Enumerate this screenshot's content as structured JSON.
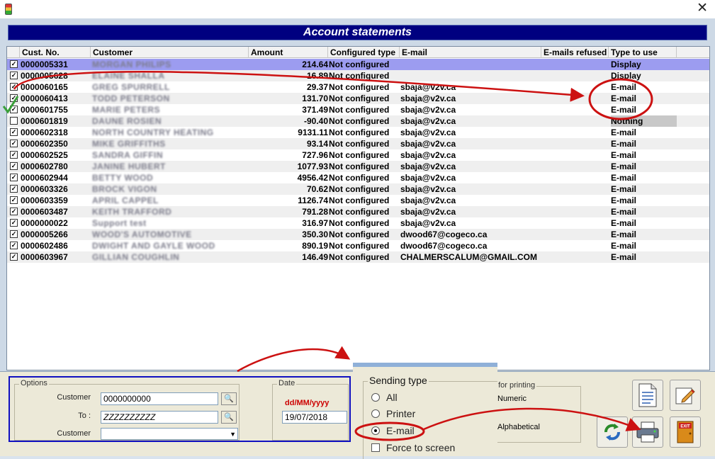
{
  "window": {
    "title": ""
  },
  "header": {
    "title": "Account statements"
  },
  "grid": {
    "columns": [
      "Cust. No.",
      "Customer",
      "Amount",
      "Configured type",
      "E-mail",
      "E-mails refused",
      "Type to use"
    ],
    "rows": [
      {
        "checked": true,
        "cust_no": "0000005331",
        "customer": "MORGAN PHILIPS",
        "amount": "214.64",
        "configured": "Not configured",
        "email": "",
        "refused": "",
        "type": "Display"
      },
      {
        "checked": true,
        "cust_no": "0000005628",
        "customer": "ELAINE SHALLA",
        "amount": "16.89",
        "configured": "Not configured",
        "email": "",
        "refused": "",
        "type": "Display"
      },
      {
        "checked": true,
        "cust_no": "0000060165",
        "customer": "GREG SPURRELL",
        "amount": "29.37",
        "configured": "Not configured",
        "email": "sbaja@v2v.ca",
        "refused": "",
        "type": "E-mail"
      },
      {
        "checked": true,
        "cust_no": "0000060413",
        "customer": "TODD PETERSON",
        "amount": "131.70",
        "configured": "Not configured",
        "email": "sbaja@v2v.ca",
        "refused": "",
        "type": "E-mail"
      },
      {
        "checked": true,
        "cust_no": "0000601755",
        "customer": "MARIE PETERS",
        "amount": "371.49",
        "configured": "Not configured",
        "email": "sbaja@v2v.ca",
        "refused": "",
        "type": "E-mail"
      },
      {
        "checked": false,
        "cust_no": "0000601819",
        "customer": "DAUNE ROSIEN",
        "amount": "-90.40",
        "configured": "Not configured",
        "email": "sbaja@v2v.ca",
        "refused": "",
        "type": "Nothing"
      },
      {
        "checked": true,
        "cust_no": "0000602318",
        "customer": "NORTH COUNTRY HEATING",
        "amount": "9131.11",
        "configured": "Not configured",
        "email": "sbaja@v2v.ca",
        "refused": "",
        "type": "E-mail"
      },
      {
        "checked": true,
        "cust_no": "0000602350",
        "customer": "MIKE GRIFFITHS",
        "amount": "93.14",
        "configured": "Not configured",
        "email": "sbaja@v2v.ca",
        "refused": "",
        "type": "E-mail"
      },
      {
        "checked": true,
        "cust_no": "0000602525",
        "customer": "SANDRA GIFFIN",
        "amount": "727.96",
        "configured": "Not configured",
        "email": "sbaja@v2v.ca",
        "refused": "",
        "type": "E-mail"
      },
      {
        "checked": true,
        "cust_no": "0000602780",
        "customer": "JANINE HUBERT",
        "amount": "1077.93",
        "configured": "Not configured",
        "email": "sbaja@v2v.ca",
        "refused": "",
        "type": "E-mail"
      },
      {
        "checked": true,
        "cust_no": "0000602944",
        "customer": "BETTY WOOD",
        "amount": "4956.42",
        "configured": "Not configured",
        "email": "sbaja@v2v.ca",
        "refused": "",
        "type": "E-mail"
      },
      {
        "checked": true,
        "cust_no": "0000603326",
        "customer": "BROCK VIGON",
        "amount": "70.62",
        "configured": "Not configured",
        "email": "sbaja@v2v.ca",
        "refused": "",
        "type": "E-mail"
      },
      {
        "checked": true,
        "cust_no": "0000603359",
        "customer": "APRIL CAPPEL",
        "amount": "1126.74",
        "configured": "Not configured",
        "email": "sbaja@v2v.ca",
        "refused": "",
        "type": "E-mail"
      },
      {
        "checked": true,
        "cust_no": "0000603487",
        "customer": "KEITH TRAFFORD",
        "amount": "791.28",
        "configured": "Not configured",
        "email": "sbaja@v2v.ca",
        "refused": "",
        "type": "E-mail"
      },
      {
        "checked": true,
        "cust_no": "0000000022",
        "customer": "Support test",
        "amount": "316.97",
        "configured": "Not configured",
        "email": "sbaja@v2v.ca",
        "refused": "",
        "type": "E-mail"
      },
      {
        "checked": true,
        "cust_no": "0000005266",
        "customer": "WOOD'S AUTOMOTIVE",
        "amount": "350.30",
        "configured": "Not configured",
        "email": "dwood67@cogeco.ca",
        "refused": "",
        "type": "E-mail"
      },
      {
        "checked": true,
        "cust_no": "0000602486",
        "customer": "DWIGHT AND GAYLE WOOD",
        "amount": "890.19",
        "configured": "Not configured",
        "email": "dwood67@cogeco.ca",
        "refused": "",
        "type": "E-mail"
      },
      {
        "checked": true,
        "cust_no": "0000603967",
        "customer": "GILLIAN COUGHLIN",
        "amount": "146.49",
        "configured": "Not configured",
        "email": "CHALMERSCALUM@GMAIL.COM",
        "refused": "",
        "type": "E-mail"
      }
    ]
  },
  "options": {
    "legend": "Options",
    "customer_from_label": "Customer",
    "customer_from_value": "0000000000",
    "customer_to_label": "To :",
    "customer_to_value": "ZZZZZZZZZZ",
    "customer_select_label": "Customer",
    "customer_select_value": ""
  },
  "date": {
    "legend": "Date",
    "format_hint": "dd/MM/yyyy",
    "value": "19/07/2018"
  },
  "sending_type": {
    "legend": "Sending type",
    "options": [
      "All",
      "Printer",
      "E-mail"
    ],
    "selected": "E-mail",
    "force_label": "Force to screen"
  },
  "sort": {
    "legend": "t for printing",
    "options": [
      "Numeric",
      "Alphabetical"
    ]
  },
  "colors": {
    "header_band": "#000080",
    "selected_row": "#9c9cf0",
    "annotation": "#cc1111",
    "options_border": "#1010c0"
  },
  "icons": [
    "document-icon",
    "edit-icon",
    "refresh-icon",
    "printer-icon",
    "exit-icon"
  ]
}
